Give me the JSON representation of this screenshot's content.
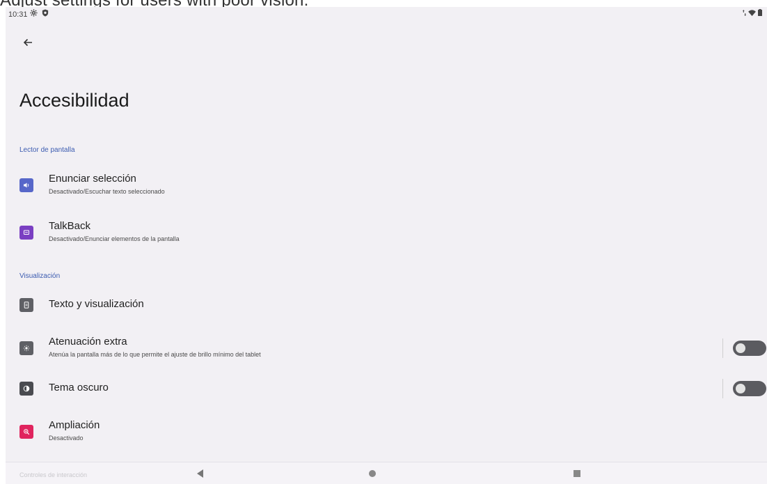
{
  "banner": {
    "text": "Adjust settings for users with poor vision."
  },
  "status_bar": {
    "time": "10:31",
    "left_icons": [
      "gear-icon",
      "shield-icon"
    ],
    "right_icons": [
      "data-arrows-icon",
      "wifi-icon",
      "battery-icon"
    ]
  },
  "header": {
    "back_icon": "arrow-left-icon",
    "title": "Accesibilidad"
  },
  "sections": [
    {
      "header": "Lector de pantalla",
      "items": [
        {
          "title": "Enunciar selección",
          "subtitle": "Desactivado/Escuchar texto seleccionado",
          "icon": "speak-icon",
          "icon_color": "#5767c9"
        },
        {
          "title": "TalkBack",
          "subtitle": "Desactivado/Enunciar elementos de la pantalla",
          "icon": "talkback-icon",
          "icon_color": "#7a3fc2"
        }
      ]
    },
    {
      "header": "Visualización",
      "items": [
        {
          "title": "Texto y visualización",
          "subtitle": "",
          "icon": "text-display-icon",
          "icon_color": "#5f6065"
        },
        {
          "title": "Atenuación extra",
          "subtitle": "Atenúa la pantalla más de lo que permite el ajuste de brillo mínimo del tablet",
          "icon": "brightness-icon",
          "icon_color": "#5f6065",
          "toggle": false
        },
        {
          "title": "Tema oscuro",
          "subtitle": "",
          "icon": "contrast-icon",
          "icon_color": "#4a4b50",
          "toggle": false
        },
        {
          "title": "Ampliación",
          "subtitle": "Desactivado",
          "icon": "magnify-icon",
          "icon_color": "#e0245e"
        }
      ]
    }
  ],
  "nav_bar": {
    "ghost_text": "Controles de interacción",
    "buttons": [
      "back-triangle-icon",
      "home-circle-icon",
      "recents-square-icon"
    ]
  },
  "colors": {
    "accent": "#3b5bb0",
    "background": "#f2f0f4",
    "toggle_off": "#5b5b60"
  }
}
